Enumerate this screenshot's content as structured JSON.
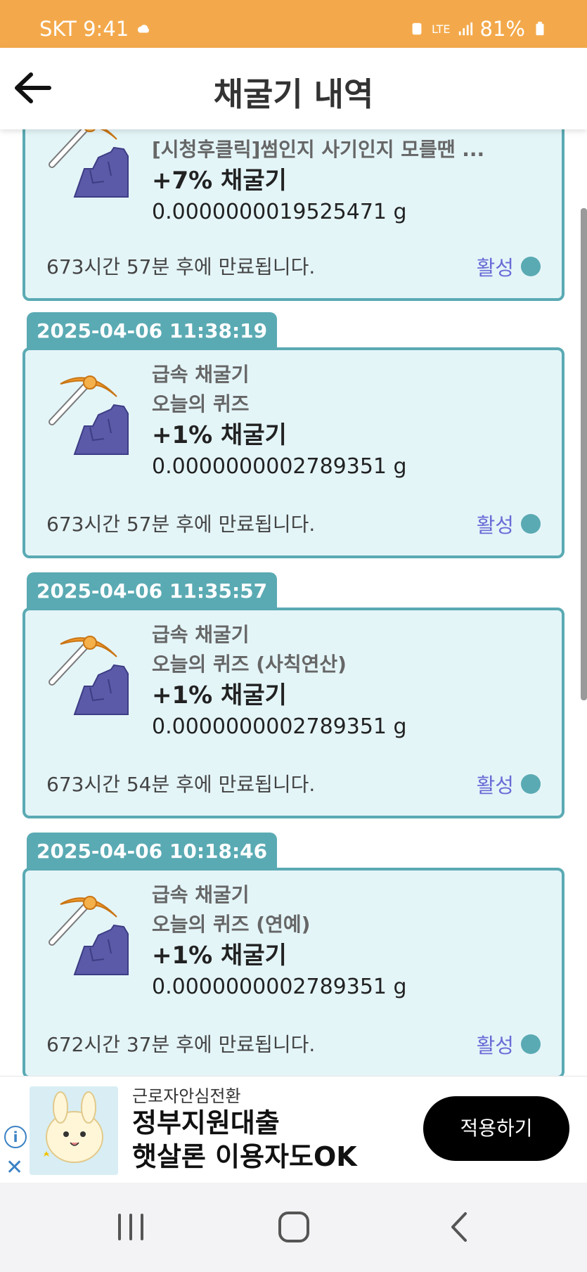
{
  "status_bar": {
    "carrier_time": "SKT 9:41",
    "network": "LTE",
    "battery": "81%"
  },
  "header": {
    "title": "채굴기 내역"
  },
  "entries": [
    {
      "date": "",
      "type": "",
      "source": "[시청후클릭]썸인지 사기인지 모를땐 ...",
      "rate": "+7% 채굴기",
      "amount": "0.0000000019525471 g",
      "expire": "673시간 57분 후에 만료됩니다.",
      "status": "활성"
    },
    {
      "date": "2025-04-06 11:38:19",
      "type": "급속 채굴기",
      "source": "오늘의 퀴즈",
      "rate": "+1% 채굴기",
      "amount": "0.0000000002789351 g",
      "expire": "673시간 57분 후에 만료됩니다.",
      "status": "활성"
    },
    {
      "date": "2025-04-06 11:35:57",
      "type": "급속 채굴기",
      "source": "오늘의 퀴즈 (사칙연산)",
      "rate": "+1% 채굴기",
      "amount": "0.0000000002789351 g",
      "expire": "673시간 54분 후에 만료됩니다.",
      "status": "활성"
    },
    {
      "date": "2025-04-06 10:18:46",
      "type": "급속 채굴기",
      "source": "오늘의 퀴즈 (연예)",
      "rate": "+1% 채굴기",
      "amount": "0.0000000002789351 g",
      "expire": "672시간 37분 후에 만료됩니다.",
      "status": "활성"
    }
  ],
  "ad": {
    "sub": "근로자안심전환",
    "headline_1": "정부지원대출",
    "headline_2": "햇살론 이용자도OK",
    "button": "적용하기",
    "info_icon": "info-icon",
    "close_icon": "close-icon"
  },
  "colors": {
    "accent": "#f3a94b",
    "teal": "#5aaab3",
    "card_bg": "#e4f5f8",
    "status_text": "#6b6bd6"
  }
}
